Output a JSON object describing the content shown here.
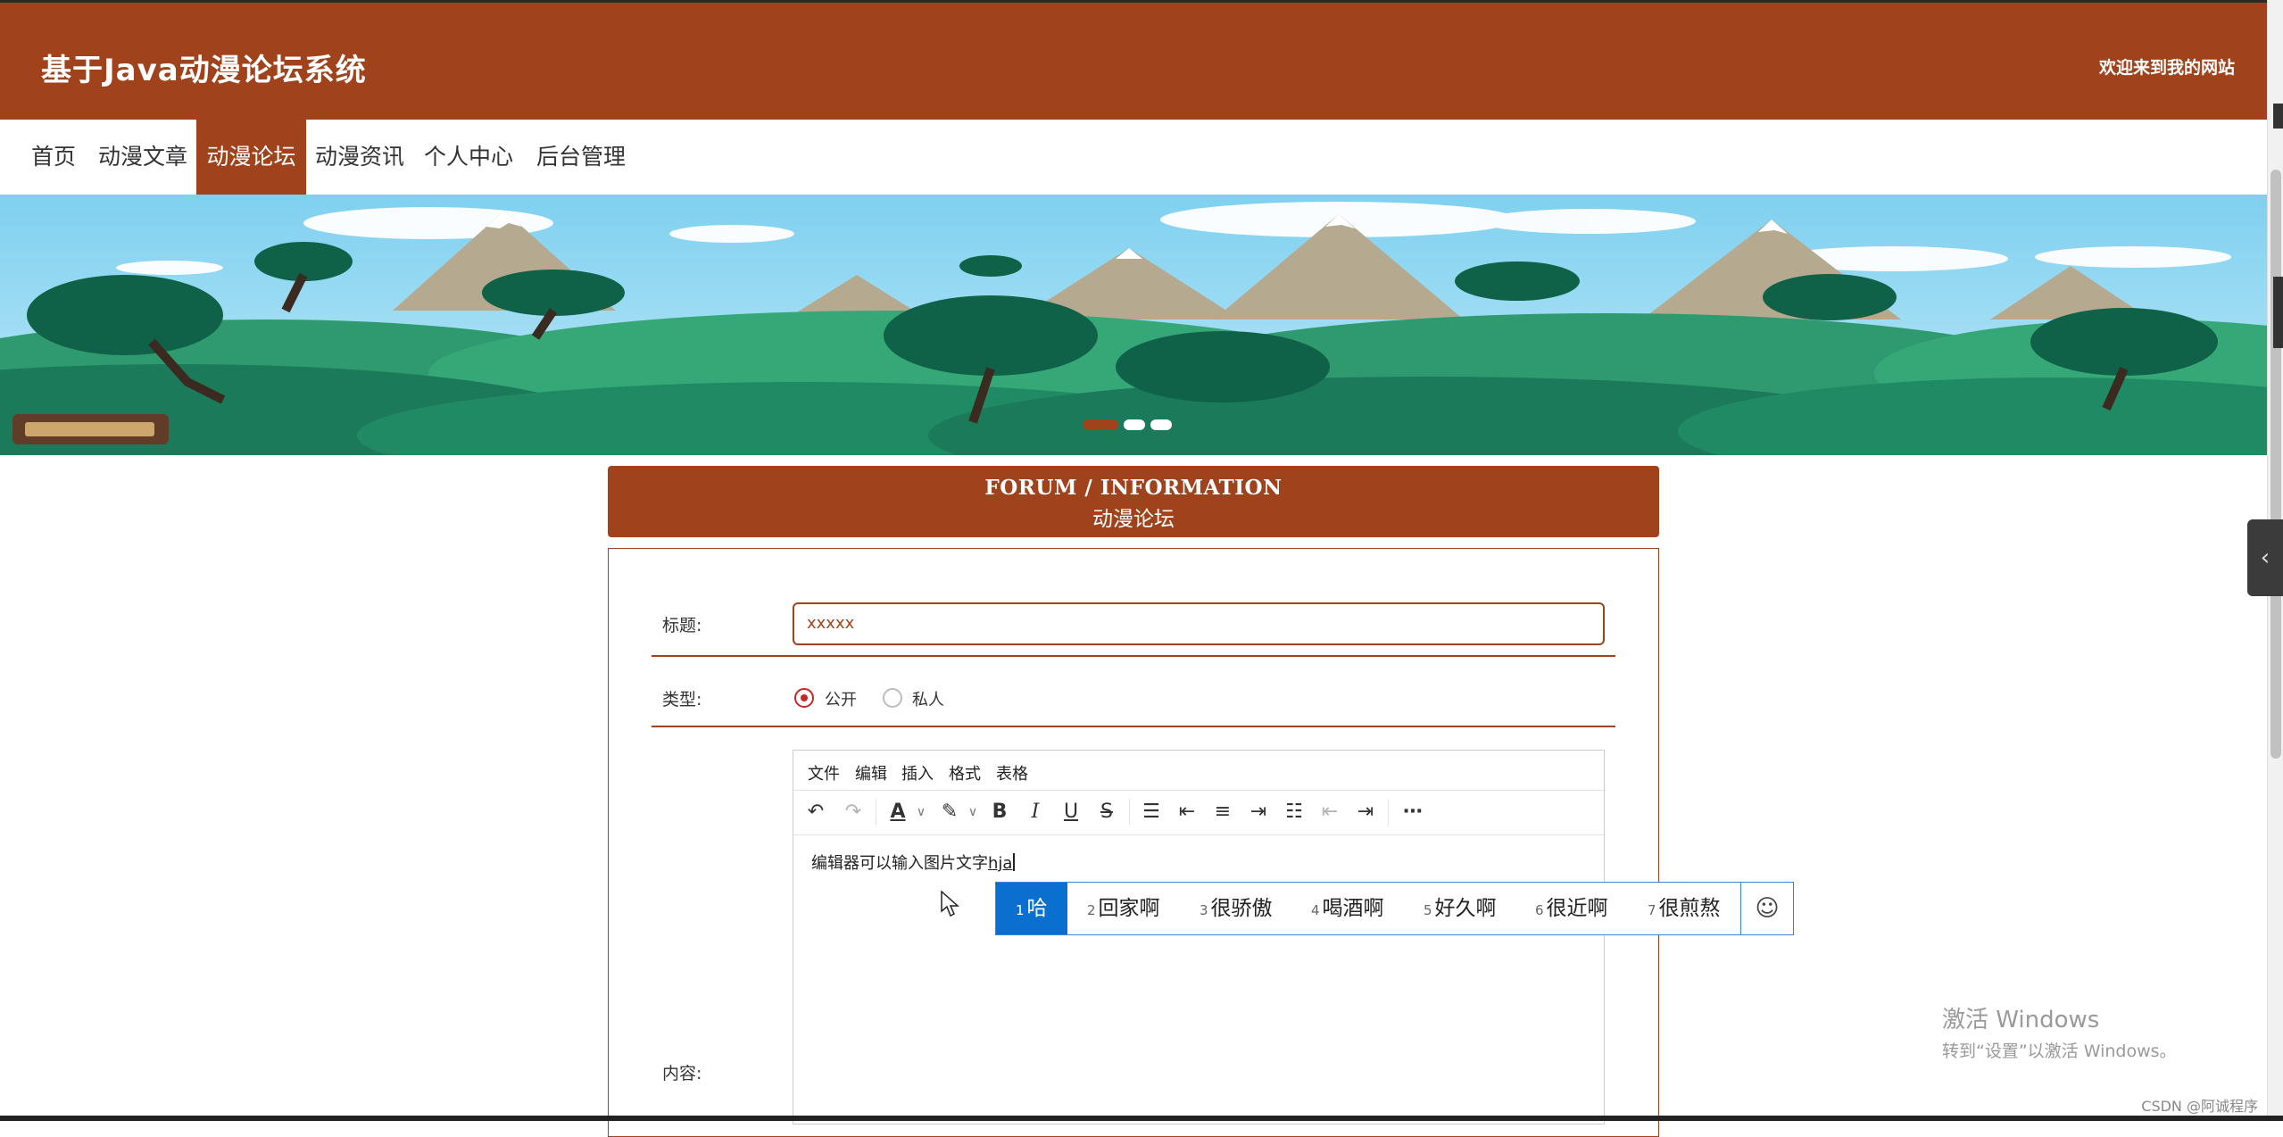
{
  "header": {
    "site_title": "基于Java动漫论坛系统",
    "welcome": "欢迎来到我的网站"
  },
  "nav": {
    "items": [
      {
        "label": "首页",
        "active": false
      },
      {
        "label": "动漫文章",
        "active": false
      },
      {
        "label": "动漫论坛",
        "active": true
      },
      {
        "label": "动漫资讯",
        "active": false
      },
      {
        "label": "个人中心",
        "active": false
      },
      {
        "label": "后台管理",
        "active": false
      }
    ]
  },
  "banner": {
    "active_slide_index": 0,
    "slide_count": 3
  },
  "section": {
    "title_en": "FORUM / INFORMATION",
    "title_cn": "动漫论坛"
  },
  "form": {
    "title_label": "标题:",
    "title_value": "xxxxx",
    "type_label": "类型:",
    "type_options": [
      "公开",
      "私人"
    ],
    "type_selected": "公开",
    "content_label": "内容:"
  },
  "editor": {
    "menu": [
      "文件",
      "编辑",
      "插入",
      "格式",
      "表格"
    ],
    "content_text": "编辑器可以输入图片文字",
    "composition_text": "hja",
    "toolbar_icons": [
      "undo-icon",
      "redo-icon",
      "text-color-icon",
      "highlight-icon",
      "bold-icon",
      "italic-icon",
      "underline-icon",
      "strikethrough-icon",
      "list-icon",
      "align-left-icon",
      "align-center-icon",
      "align-right-icon",
      "align-justify-icon",
      "outdent-icon",
      "indent-icon",
      "more-icon"
    ]
  },
  "ime": {
    "candidates": [
      {
        "num": "1",
        "text": "哈"
      },
      {
        "num": "2",
        "text": "回家啊"
      },
      {
        "num": "3",
        "text": "很骄傲"
      },
      {
        "num": "4",
        "text": "喝酒啊"
      },
      {
        "num": "5",
        "text": "好久啊"
      },
      {
        "num": "6",
        "text": "很近啊"
      },
      {
        "num": "7",
        "text": "很煎熬"
      }
    ],
    "selected_index": 0
  },
  "os": {
    "activate_title": "激活 Windows",
    "activate_sub": "转到“设置”以激活 Windows。",
    "watermark": "CSDN @阿诚程序"
  },
  "colors": {
    "brand": "#a0431c",
    "ime_select": "#0b6fd0",
    "radio_on": "#c62828"
  }
}
